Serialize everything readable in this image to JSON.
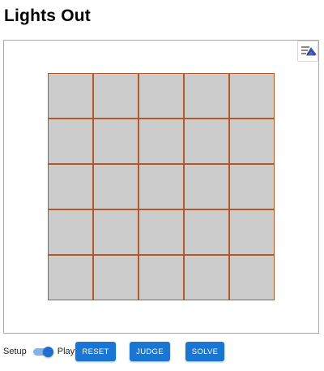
{
  "title": "Lights Out",
  "menu": {
    "icon": "layers-menu-icon"
  },
  "board": {
    "rows": 5,
    "cols": 5,
    "cell_color_off": "#cccccc",
    "grid_line_color": "#b05a2a",
    "cells": [
      [
        0,
        0,
        0,
        0,
        0
      ],
      [
        0,
        0,
        0,
        0,
        0
      ],
      [
        0,
        0,
        0,
        0,
        0
      ],
      [
        0,
        0,
        0,
        0,
        0
      ],
      [
        0,
        0,
        0,
        0,
        0
      ]
    ]
  },
  "controls": {
    "setup_label": "Setup",
    "play_label": "Play",
    "mode_selected": "Play",
    "reset_label": "RESET",
    "judge_label": "JUDGE",
    "solve_label": "SOLVE",
    "button_color": "#1976d2"
  }
}
